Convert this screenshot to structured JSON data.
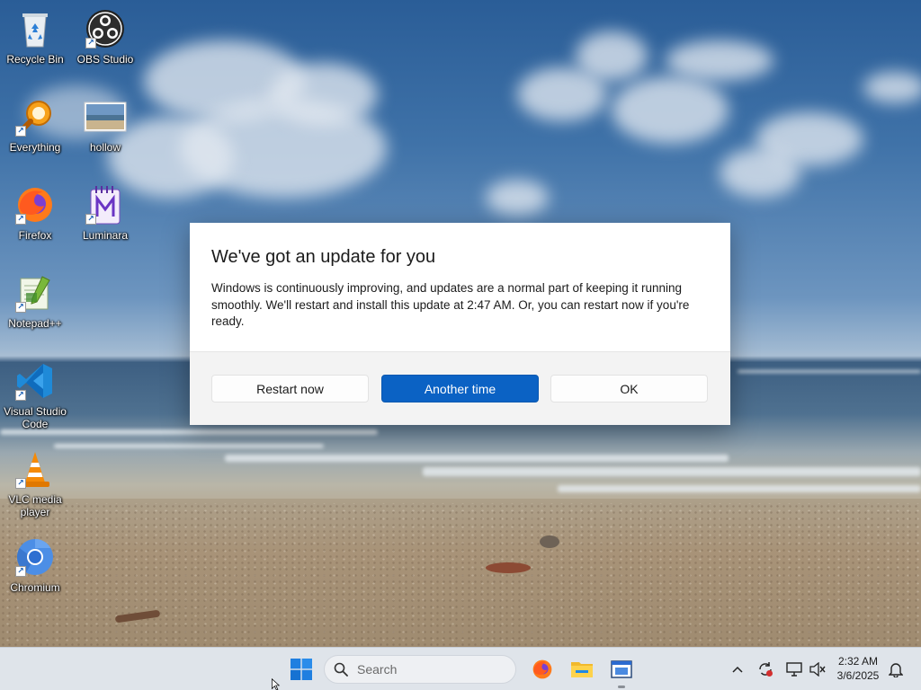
{
  "desktop": {
    "icons": [
      {
        "name": "recycle-bin",
        "label": "Recycle Bin",
        "icon": "recycle-bin-icon"
      },
      {
        "name": "obs-studio",
        "label": "OBS Studio",
        "icon": "obs-icon"
      },
      {
        "name": "everything",
        "label": "Everything",
        "icon": "magnifier-icon"
      },
      {
        "name": "hollow",
        "label": "hollow",
        "icon": "image-thumbnail-icon"
      },
      {
        "name": "firefox",
        "label": "Firefox",
        "icon": "firefox-icon"
      },
      {
        "name": "luminara",
        "label": "Luminara",
        "icon": "luminara-icon"
      },
      {
        "name": "notepad-plus-plus",
        "label": "Notepad++",
        "icon": "notepad-icon"
      },
      {
        "name": "visual-studio-code",
        "label": "Visual Studio Code",
        "icon": "vscode-icon"
      },
      {
        "name": "vlc",
        "label": "VLC media player",
        "icon": "vlc-cone-icon"
      },
      {
        "name": "chromium",
        "label": "Chromium",
        "icon": "chromium-icon"
      }
    ]
  },
  "dialog": {
    "title": "We've got an update for you",
    "message": "Windows is continuously improving, and updates are a normal part of keeping it running smoothly. We'll restart and install this update at 2:47 AM. Or, you can restart now if you're ready.",
    "buttons": {
      "restart_now": "Restart now",
      "another_time": "Another time",
      "ok": "OK"
    },
    "primary_color": "#0b62c4"
  },
  "taskbar": {
    "search_placeholder": "Search",
    "pinned": [
      "start-icon",
      "firefox-icon",
      "file-explorer-icon",
      "app-window-icon"
    ],
    "tray_icons": [
      "chevron-up-icon",
      "sync-alert-icon",
      "network-icon",
      "volume-muted-icon",
      "notification-bell-icon"
    ],
    "clock": {
      "time": "2:32 AM",
      "date": "3/6/2025"
    }
  }
}
